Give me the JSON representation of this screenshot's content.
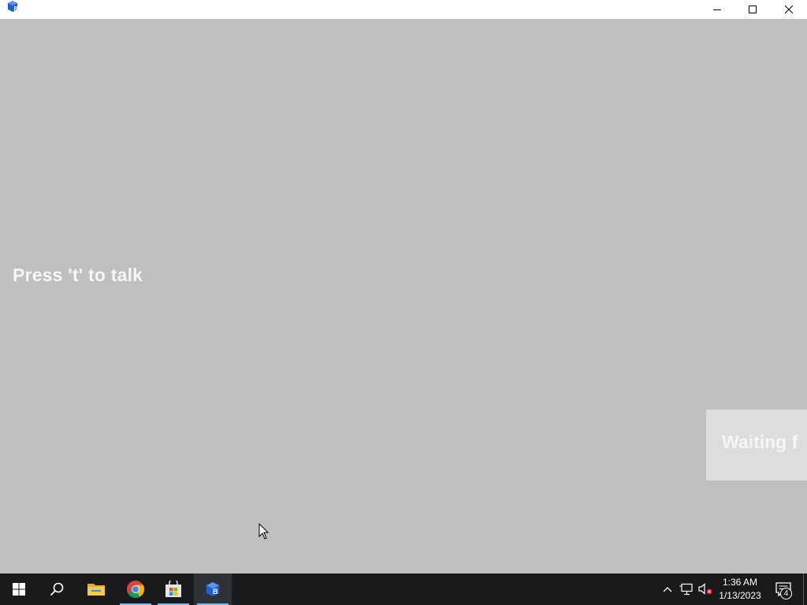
{
  "window": {
    "app_icon": "blue-cube-app-icon",
    "controls": [
      "minimize-icon",
      "maximize-icon",
      "close-icon"
    ]
  },
  "game": {
    "talk_hint": "Press 't' to talk",
    "waiting_text": "Waiting f"
  },
  "taskbar": {
    "apps": [
      "windows-start-icon",
      "search-icon",
      "file-explorer-icon",
      "chrome-icon",
      "microsoft-store-icon",
      "blue-cube-app-icon"
    ],
    "clock": {
      "time": "1:36 AM",
      "date": "1/13/2023"
    },
    "notification_count": "4"
  },
  "colors": {
    "background": "#bfbfbf",
    "taskbar": "#191a1c",
    "accent": "#76b9ed",
    "text_light": "#f6f6f6"
  }
}
